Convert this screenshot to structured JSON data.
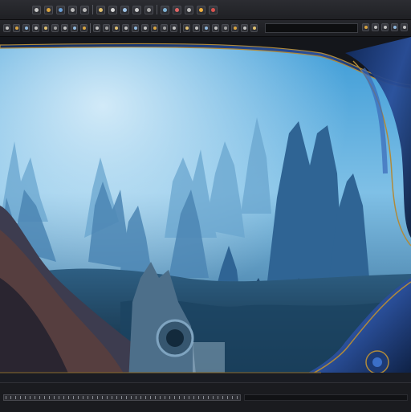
{
  "app": {
    "title": ""
  },
  "toolbar_top": {
    "icons": [
      {
        "name": "new-file-icon",
        "color": "#c9c9c9"
      },
      {
        "name": "open-icon",
        "color": "#d9a441"
      },
      {
        "name": "save-icon",
        "color": "#6aa0d8"
      },
      {
        "name": "undo-icon",
        "color": "#b8b8b8"
      },
      {
        "name": "redo-icon",
        "color": "#b8b8b8"
      },
      {
        "name": "brush-icon",
        "color": "#e0c070"
      },
      {
        "name": "eraser-icon",
        "color": "#d6d6d6"
      },
      {
        "name": "select-icon",
        "color": "#9fc5e8"
      },
      {
        "name": "move-icon",
        "color": "#cccccc"
      },
      {
        "name": "zoom-icon",
        "color": "#aaaaaa"
      },
      {
        "name": "layers-icon",
        "color": "#7fb3d5"
      },
      {
        "name": "color-icon",
        "color": "#e06666"
      },
      {
        "name": "settings-icon",
        "color": "#bbbbbb"
      },
      {
        "name": "render-icon",
        "color": "#f0b040"
      },
      {
        "name": "close-icon",
        "color": "#d9534f"
      }
    ]
  },
  "toolbar_second": {
    "icons": [
      {
        "name": "tool-a-icon",
        "color": "#c0c0c0"
      },
      {
        "name": "tool-b-icon",
        "color": "#d9a441"
      },
      {
        "name": "tool-c-icon",
        "color": "#8fb8de"
      },
      {
        "name": "tool-d-icon",
        "color": "#c0c0c0"
      },
      {
        "name": "tool-e-icon",
        "color": "#e0c070"
      },
      {
        "name": "tool-f-icon",
        "color": "#a0a0a0"
      },
      {
        "name": "tool-g-icon",
        "color": "#c0c0c0"
      },
      {
        "name": "tool-h-icon",
        "color": "#8fb8de"
      },
      {
        "name": "tool-i-icon",
        "color": "#d9a441"
      },
      {
        "name": "tool-j-icon",
        "color": "#c0c0c0"
      },
      {
        "name": "tool-k-icon",
        "color": "#a0a0a0"
      },
      {
        "name": "tool-l-icon",
        "color": "#e0c070"
      },
      {
        "name": "tool-m-icon",
        "color": "#c0c0c0"
      },
      {
        "name": "tool-n-icon",
        "color": "#8fb8de"
      },
      {
        "name": "tool-o-icon",
        "color": "#c0c0c0"
      },
      {
        "name": "tool-p-icon",
        "color": "#d9a441"
      },
      {
        "name": "tool-q-icon",
        "color": "#a0a0a0"
      },
      {
        "name": "tool-r-icon",
        "color": "#c0c0c0"
      },
      {
        "name": "tool-s-icon",
        "color": "#e0c070"
      },
      {
        "name": "tool-t-icon",
        "color": "#c0c0c0"
      },
      {
        "name": "tool-u-icon",
        "color": "#8fb8de"
      },
      {
        "name": "tool-v-icon",
        "color": "#c0c0c0"
      },
      {
        "name": "tool-w-icon",
        "color": "#a0a0a0"
      },
      {
        "name": "tool-x-icon",
        "color": "#d9a441"
      },
      {
        "name": "tool-y-icon",
        "color": "#c0c0c0"
      },
      {
        "name": "tool-z-icon",
        "color": "#e0c070"
      }
    ],
    "right_icons": [
      {
        "name": "panel-a-icon",
        "color": "#d9a441"
      },
      {
        "name": "panel-b-icon",
        "color": "#c0c0c0"
      },
      {
        "name": "panel-c-icon",
        "color": "#c0c0c0"
      },
      {
        "name": "panel-d-icon",
        "color": "#8fb8de"
      },
      {
        "name": "panel-e-icon",
        "color": "#c0c0c0"
      }
    ]
  },
  "viewport": {
    "scene": "fantasy-landscape",
    "colors": {
      "sky": "#4aa3d8",
      "haze": "#9ccbe8",
      "deep": "#0d2a4a",
      "frame": "#1f3f7a",
      "gold": "#b08a3a"
    }
  }
}
